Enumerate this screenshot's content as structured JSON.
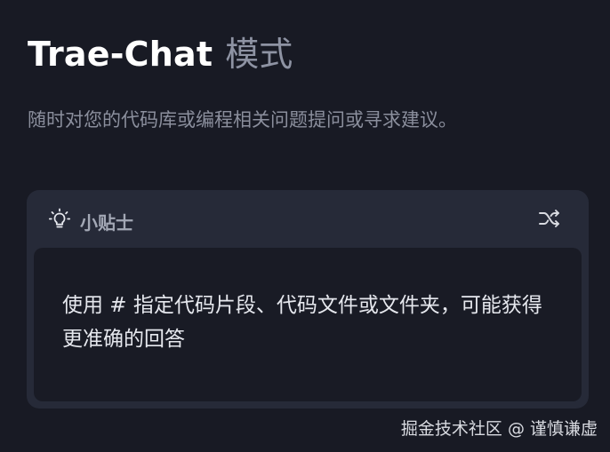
{
  "header": {
    "title": "Trae-Chat",
    "title_suffix": "模式",
    "subtitle": "随时对您的代码库或编程相关问题提问或寻求建议。"
  },
  "tip": {
    "icon": "lightbulb-icon",
    "label": "小贴士",
    "shuffle_icon": "shuffle-icon",
    "text": "使用 # 指定代码片段、代码文件或文件夹，可能获得更准确的回答"
  },
  "watermark": {
    "text": "掘金技术社区 @ 谨慎谦虚"
  },
  "colors": {
    "background": "#181a24",
    "card": "#262a38",
    "card_inner": "#191b25",
    "title": "#ffffff",
    "muted": "#8e93a3"
  }
}
